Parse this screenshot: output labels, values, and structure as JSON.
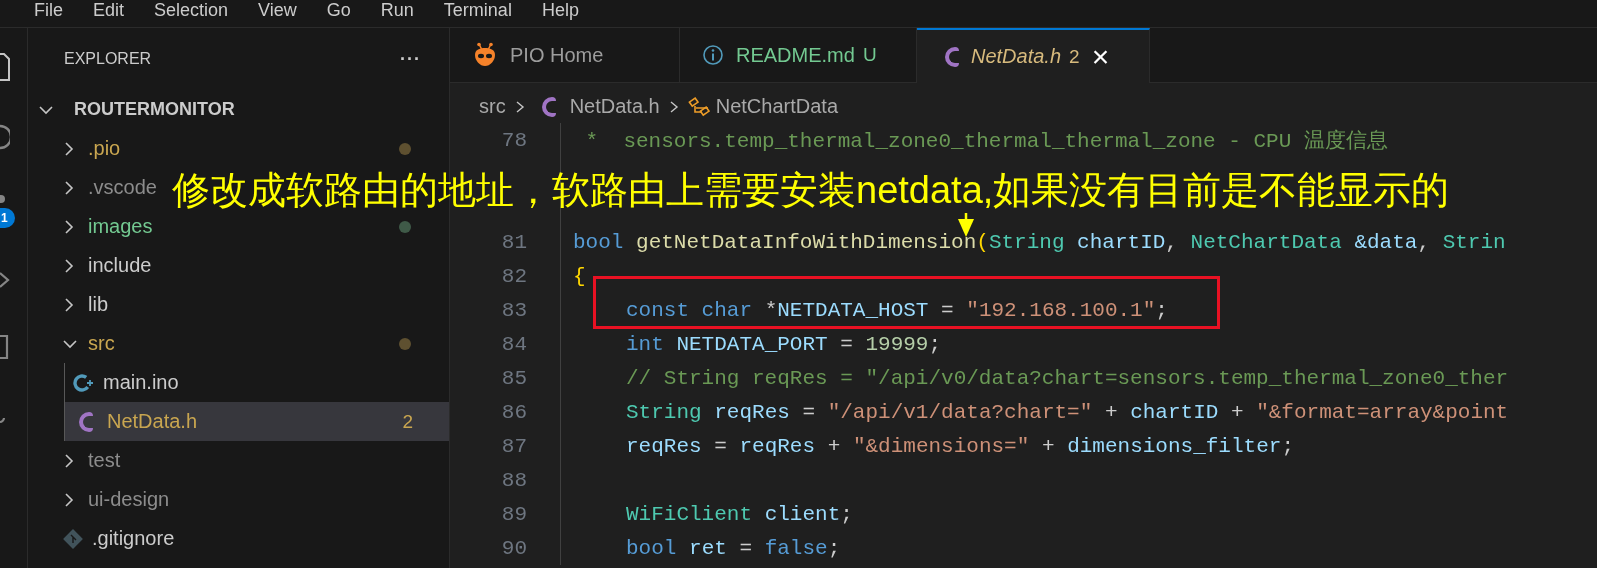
{
  "menu": [
    "File",
    "Edit",
    "Selection",
    "View",
    "Go",
    "Run",
    "Terminal",
    "Help"
  ],
  "activity_bar": {
    "badge": "1"
  },
  "explorer": {
    "title": "EXPLORER",
    "more": "···",
    "root": {
      "label": "ROUTERMONITOR",
      "expanded": true
    },
    "items": [
      {
        "label": ".pio",
        "kind": "folder",
        "expanded": false,
        "color": "#c9a650",
        "dot": {
          "color": "#5e5030"
        },
        "selected": false
      },
      {
        "label": ".vscode",
        "kind": "folder",
        "expanded": false,
        "color": "#8c8c8c",
        "selected": false
      },
      {
        "label": "images",
        "kind": "folder",
        "expanded": false,
        "color": "#73c991",
        "dot": {
          "color": "#3f5a48"
        },
        "selected": false
      },
      {
        "label": "include",
        "kind": "folder",
        "expanded": false,
        "color": "#cccccc",
        "selected": false
      },
      {
        "label": "lib",
        "kind": "folder",
        "expanded": false,
        "color": "#cccccc",
        "selected": false
      },
      {
        "label": "src",
        "kind": "folder",
        "expanded": true,
        "color": "#c9a650",
        "dot": {
          "color": "#5e5030"
        },
        "selected": false,
        "children": [
          {
            "label": "main.ino",
            "kind": "cpp",
            "color": "#cccccc",
            "selected": false
          },
          {
            "label": "NetData.h",
            "kind": "c",
            "color": "#c9a650",
            "badge": "2",
            "selected": true
          }
        ]
      },
      {
        "label": "test",
        "kind": "folder",
        "expanded": false,
        "color": "#8c8c8c",
        "selected": false
      },
      {
        "label": "ui-design",
        "kind": "folder",
        "expanded": false,
        "color": "#8c8c8c",
        "selected": false
      },
      {
        "label": ".gitignore",
        "kind": "git",
        "color": "#cccccc",
        "selected": false
      }
    ]
  },
  "tabs": [
    {
      "label": "PIO Home",
      "kind": "pio",
      "selected": false,
      "italic": false,
      "color": "#9d9d9d"
    },
    {
      "label": "README.md",
      "kind": "info",
      "selected": false,
      "italic": false,
      "color": "#73c991",
      "badge": "U"
    },
    {
      "label": "NetData.h",
      "kind": "c",
      "selected": true,
      "italic": true,
      "color": "#d7ba7d",
      "badge": "2",
      "close": "×"
    }
  ],
  "breadcrumb": [
    {
      "label": "src",
      "kind": "folder"
    },
    {
      "label": "NetData.h",
      "kind": "c"
    },
    {
      "label": "NetChartData",
      "kind": "struct"
    }
  ],
  "code": [
    {
      "kind": "line",
      "number": "78",
      "indented": false,
      "tokens": [
        {
          "kind": "comment",
          "text": " *  sensors.temp_thermal_zone0_thermal_thermal_zone - CPU 温度信息"
        }
      ]
    },
    {
      "kind": "covered"
    },
    {
      "kind": "covered"
    },
    {
      "kind": "line",
      "number": "81",
      "indented": false,
      "tokens": [
        {
          "kind": "keyword",
          "text": "bool"
        },
        {
          "kind": "function",
          "text": " getNetDataInfoWithDimension"
        },
        {
          "kind": "brace",
          "text": "("
        },
        {
          "kind": "type",
          "text": "String"
        },
        {
          "kind": "variable",
          "text": " chartID"
        },
        {
          "kind": "plain",
          "text": ", "
        },
        {
          "kind": "type",
          "text": "NetChartData"
        },
        {
          "kind": "variable",
          "text": " &data"
        },
        {
          "kind": "plain",
          "text": ", "
        },
        {
          "kind": "type",
          "text": "Strin"
        }
      ]
    },
    {
      "kind": "line",
      "number": "82",
      "indented": false,
      "tokens": [
        {
          "kind": "brace",
          "text": "{"
        }
      ]
    },
    {
      "kind": "line",
      "number": "83",
      "indented": true,
      "highlighted": true,
      "tokens": [
        {
          "kind": "keyword",
          "text": "const"
        },
        {
          "kind": "keyword",
          "text": " char"
        },
        {
          "kind": "plain",
          "text": " *"
        },
        {
          "kind": "variable",
          "text": "NETDATA_HOST"
        },
        {
          "kind": "plain",
          "text": " = "
        },
        {
          "kind": "string",
          "text": "\"192.168.100.1\""
        },
        {
          "kind": "plain",
          "text": ";"
        }
      ]
    },
    {
      "kind": "line",
      "number": "84",
      "indented": true,
      "tokens": [
        {
          "kind": "keyword",
          "text": "int"
        },
        {
          "kind": "variable",
          "text": " NETDATA_PORT"
        },
        {
          "kind": "plain",
          "text": " = "
        },
        {
          "kind": "number",
          "text": "19999"
        },
        {
          "kind": "plain",
          "text": ";"
        }
      ]
    },
    {
      "kind": "line",
      "number": "85",
      "indented": true,
      "tokens": [
        {
          "kind": "comment",
          "text": "// String reqRes = \"/api/v0/data?chart=sensors.temp_thermal_zone0_ther"
        }
      ]
    },
    {
      "kind": "line",
      "number": "86",
      "indented": true,
      "tokens": [
        {
          "kind": "type",
          "text": "String"
        },
        {
          "kind": "variable",
          "text": " reqRes"
        },
        {
          "kind": "plain",
          "text": " = "
        },
        {
          "kind": "string",
          "text": "\"/api/v1/data?chart=\""
        },
        {
          "kind": "plain",
          "text": " + "
        },
        {
          "kind": "variable",
          "text": "chartID"
        },
        {
          "kind": "plain",
          "text": " + "
        },
        {
          "kind": "string",
          "text": "\"&format=array&point"
        }
      ]
    },
    {
      "kind": "line",
      "number": "87",
      "indented": true,
      "tokens": [
        {
          "kind": "variable",
          "text": "reqRes"
        },
        {
          "kind": "plain",
          "text": " = "
        },
        {
          "kind": "variable",
          "text": "reqRes"
        },
        {
          "kind": "plain",
          "text": " + "
        },
        {
          "kind": "string",
          "text": "\"&dimensions=\""
        },
        {
          "kind": "plain",
          "text": " + "
        },
        {
          "kind": "variable",
          "text": "dimensions_filter"
        },
        {
          "kind": "plain",
          "text": ";"
        }
      ]
    },
    {
      "kind": "line",
      "number": "88",
      "indented": false
    },
    {
      "kind": "line",
      "number": "89",
      "indented": true,
      "tokens": [
        {
          "kind": "type",
          "text": "WiFiClient"
        },
        {
          "kind": "variable",
          "text": " client"
        },
        {
          "kind": "plain",
          "text": ";"
        }
      ]
    },
    {
      "kind": "line",
      "number": "90",
      "indented": true,
      "tokens": [
        {
          "kind": "keyword",
          "text": "bool"
        },
        {
          "kind": "variable",
          "text": " ret"
        },
        {
          "kind": "plain",
          "text": " = "
        },
        {
          "kind": "keyword",
          "text": "false"
        },
        {
          "kind": "plain",
          "text": ";"
        }
      ]
    }
  ],
  "annotation": {
    "text": "修改成软路由的地址，软路由上需要安装netdata,如果没有目前是不能显示的",
    "arrow": true
  }
}
